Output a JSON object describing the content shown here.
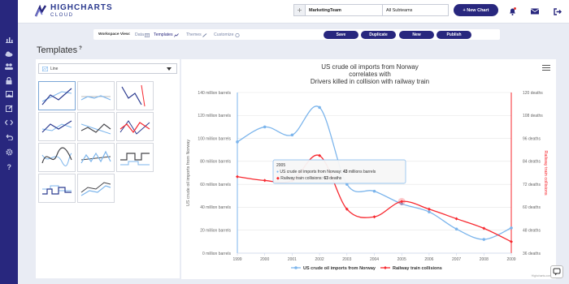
{
  "brand": {
    "name": "HIGHCHARTS",
    "sub": "CLOUD"
  },
  "header": {
    "team": "MarketingTeam",
    "subteams": "All Subteams",
    "new_chart": "+ New Chart"
  },
  "toolbar": {
    "label": "Workspace View:",
    "tabs": [
      "Data",
      "Templates",
      "Themes",
      "Customize"
    ],
    "buttons": [
      "Save",
      "Duplicate",
      "New",
      "Publish"
    ]
  },
  "templates": {
    "title": "Templates",
    "info": "?",
    "dropdown": "Line"
  },
  "tooltip": {
    "year": "2005",
    "line1_label": "US crude oil imports from Norway: ",
    "line1_value": "43",
    "line1_unit": " millions barrels",
    "line2_label": "Railway train collisions: ",
    "line2_value": "63",
    "line2_unit": " deaths"
  },
  "credits": "Highcharts.com",
  "colors": {
    "brand": "#28277e",
    "series1": "#7cb5ec",
    "series2": "#f7282f"
  },
  "chart_data": {
    "type": "line",
    "title": [
      "US crude oil imports from Norway",
      "correlates with",
      "Drivers killed in collision with railway train"
    ],
    "x": [
      1999,
      2000,
      2001,
      2002,
      2003,
      2004,
      2005,
      2006,
      2007,
      2008,
      2009
    ],
    "ylabel": "US crude oil imports from Norway",
    "y2label": "Railway train collisions",
    "ylim": [
      0,
      140
    ],
    "y2lim": [
      36,
      120
    ],
    "yticks": [
      "0 million barrels",
      "20 million barrels",
      "40 million barrels",
      "60 million barrels",
      "80 million barrels",
      "100 million barrels",
      "120 million barrels",
      "140 million barrels"
    ],
    "y2ticks": [
      "36 deaths",
      "48 deaths",
      "60 deaths",
      "72 deaths",
      "84 deaths",
      "96 deaths",
      "108 deaths",
      "120 deaths"
    ],
    "series": [
      {
        "name": "US crude oil imports from Norway",
        "axis": "left",
        "color": "#7cb5ec",
        "values": [
          97,
          110,
          103,
          127,
          60,
          54,
          43,
          36,
          21,
          12,
          22
        ]
      },
      {
        "name": "Railway train collisions",
        "axis": "right",
        "color": "#f7282f",
        "values": [
          76,
          74,
          74,
          87,
          59,
          55,
          63,
          59,
          54,
          49,
          42
        ]
      }
    ],
    "legend": "bottom-center",
    "grid": true
  }
}
